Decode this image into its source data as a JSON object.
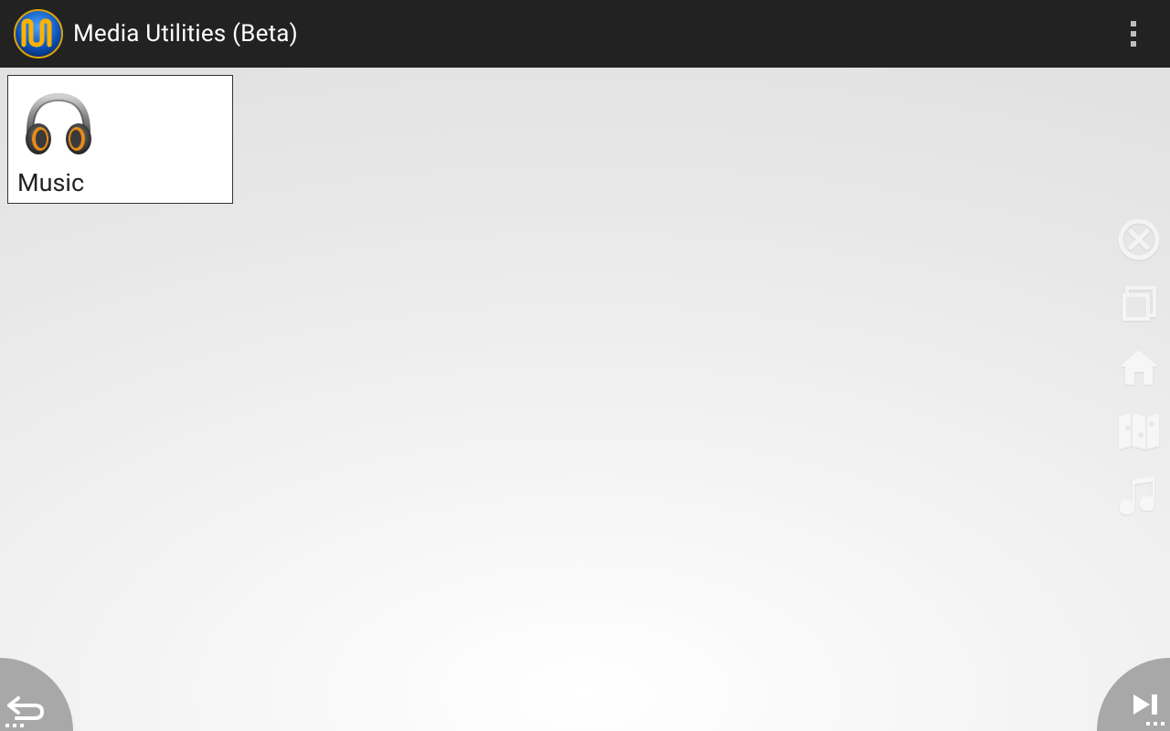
{
  "header": {
    "title": "Media Utilities (Beta)"
  },
  "grid": {
    "items": [
      {
        "label": "Music",
        "icon": "headphones-icon"
      }
    ]
  },
  "sideToolbar": {
    "items": [
      {
        "name": "close-icon"
      },
      {
        "name": "window-icon"
      },
      {
        "name": "home-icon"
      },
      {
        "name": "map-icon"
      },
      {
        "name": "music-icon"
      }
    ]
  },
  "corners": {
    "left": "back-icon",
    "right": "next-track-icon"
  }
}
